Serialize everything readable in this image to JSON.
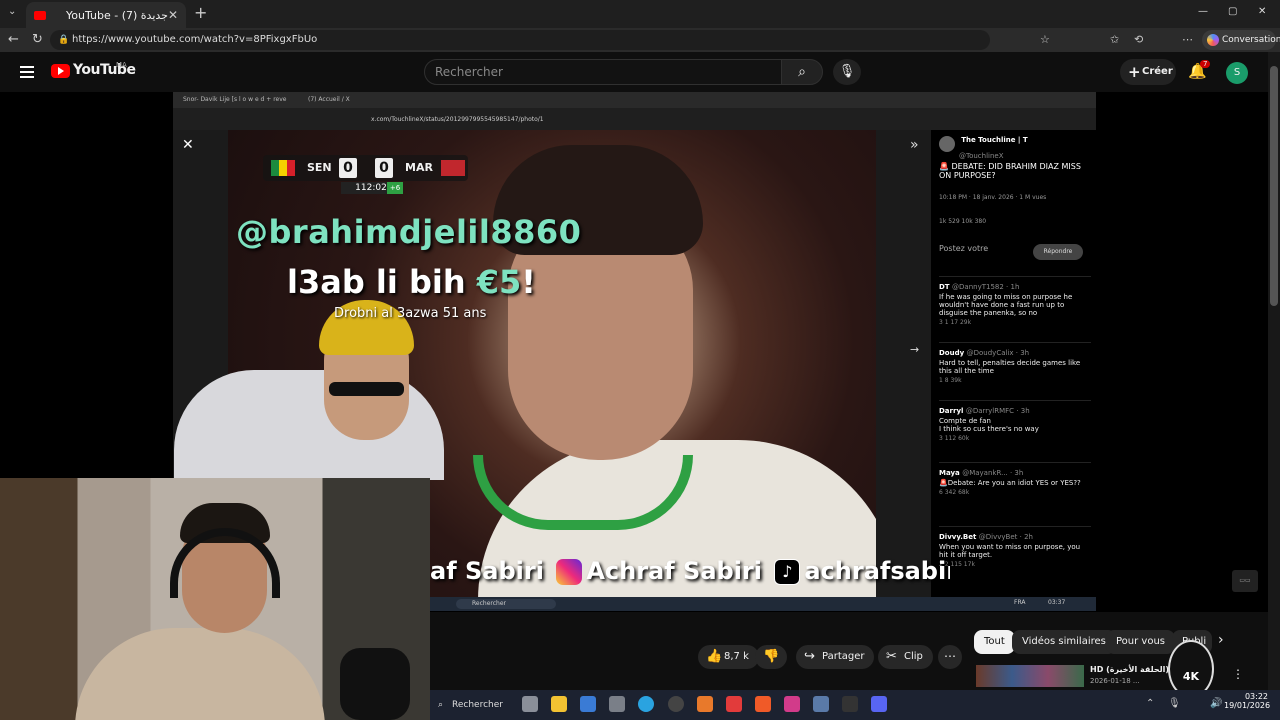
{
  "browser": {
    "tab_title": "YouTube - تا حاجة ما جديدة (7)",
    "tab_close": "✕",
    "new_tab": "+",
    "url": "https://www.youtube.com/watch?v=8PFixgxFbUo",
    "conversation_label": "Conversation",
    "window_controls": [
      "—",
      "▢",
      "✕"
    ]
  },
  "yt_header": {
    "logo_text": "YouTube",
    "country": "MA",
    "search_placeholder": "Rechercher",
    "create_label": "Créer",
    "notifications_count": "7",
    "avatar_letter": "S"
  },
  "inner_browser": {
    "tab1": "Snor- Davik Lije [s l o w e d + reve",
    "tab2": "(7) Accueil / X",
    "url": "x.com/TouchlineX/status/2012997995545985147/photo/1"
  },
  "scoreboard": {
    "home": "SEN",
    "home_score": "0",
    "away_score": "0",
    "away": "MAR",
    "clock": "112:02",
    "added": "+6"
  },
  "overlay": {
    "handle": "@brahimdjelil8860",
    "line2_prefix": "l3ab li bih ",
    "line2_amount": "€5",
    "line2_suffix": "!",
    "line3": "Drobni al 3azwa 51 ans"
  },
  "tweet": {
    "account_name": "The Touchline | T",
    "account_handle": "@TouchlineX",
    "text": "🚨 DEBATE: DID BRAHIM DIAZ MISS ON PURPOSE?",
    "meta": "10:18 PM · 18 janv. 2026 · 1 M vues",
    "stats": "1k   529   10k   380",
    "reply_placeholder": "Postez votre",
    "reply_button": "Répondre",
    "replies": [
      {
        "name": "DT",
        "handle": "@DannyT1582 · 1h",
        "text": "If he was going to miss on purpose he wouldn't have done a fast run up to disguise the panenka, so no",
        "stats": "3   1   17   29k"
      },
      {
        "name": "Doudy",
        "handle": "@DoudyCalix · 3h",
        "text": "Hard to tell, penalties decide games like this all the time",
        "stats": "1   8   39k"
      },
      {
        "name": "Darryl",
        "handle": "@DarrylRMFC · 3h",
        "text": "Compte de fan\nI think so cus there's no way",
        "stats": "3   112   60k"
      },
      {
        "name": "Maya",
        "handle": "@MayankR... · 3h",
        "text": "🚨Debate: Are you an idiot YES or YES??",
        "stats": "6   342   68k"
      },
      {
        "name": "Divvy.Bet",
        "handle": "@DivvyBet · 2h",
        "text": "When you want to miss on purpose, you hit it off target.",
        "stats": "2   2   115   17k"
      }
    ]
  },
  "banner": {
    "part1": "af Sabiri",
    "part2": "Achraf Sabiri",
    "part3": "achrafsabiri521"
  },
  "inner_taskbar": {
    "search": "Rechercher",
    "tray": "FRA",
    "time": "03:37"
  },
  "chips": [
    "Tout",
    "Vidéos similaires",
    "Pour vous",
    "Publi"
  ],
  "actions": {
    "likes": "8,7 k",
    "share": "Partager",
    "clip": "Clip"
  },
  "recommendation": {
    "title": "HD برنامج (الحلقة الأخيرة)",
    "subtitle": "2026-01-18 ..."
  },
  "watermark": "4K",
  "taskbar": {
    "search": "Rechercher",
    "time": "03:22",
    "date": "19/01/2026"
  }
}
